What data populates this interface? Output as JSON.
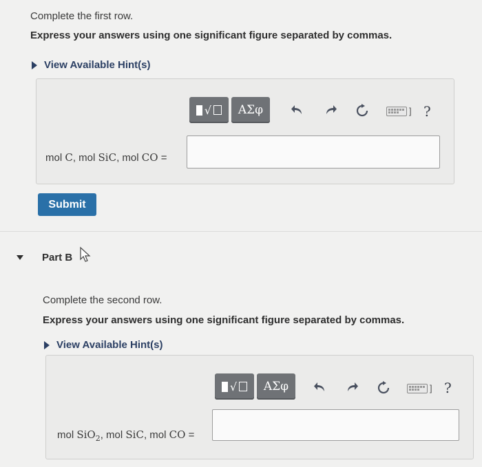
{
  "partA": {
    "instruction": "Complete the first row.",
    "directions": "Express your answers using one significant figure separated by commas.",
    "hint_label": "View Available Hint(s)",
    "toolbar": {
      "greek_label": "ΑΣφ",
      "help_label": "?"
    },
    "answer_label": {
      "p1": "mol ",
      "m1": "C",
      "p2": ", mol ",
      "m2": "SiC",
      "p3": ", mol ",
      "m3": "CO",
      "p4": " ="
    },
    "answer_value": "",
    "submit_label": "Submit"
  },
  "partB": {
    "title": "Part B",
    "instruction": "Complete the second row.",
    "directions": "Express your answers using one significant figure separated by commas.",
    "hint_label": "View Available Hint(s)",
    "toolbar": {
      "greek_label": "ΑΣφ",
      "help_label": "?"
    },
    "answer_label": {
      "p1": "mol ",
      "m1": "SiO",
      "sub1": "2",
      "p2": ", mol ",
      "m2": "SiC",
      "p3": ", mol ",
      "m3": "CO",
      "p4": " ="
    },
    "answer_value": ""
  },
  "icons": [
    "template-fraction-sqrt-icon",
    "undo-icon",
    "redo-icon",
    "reset-icon",
    "keyboard-icon",
    "help-icon",
    "collapse-caret-icon",
    "mouse-cursor-icon"
  ]
}
